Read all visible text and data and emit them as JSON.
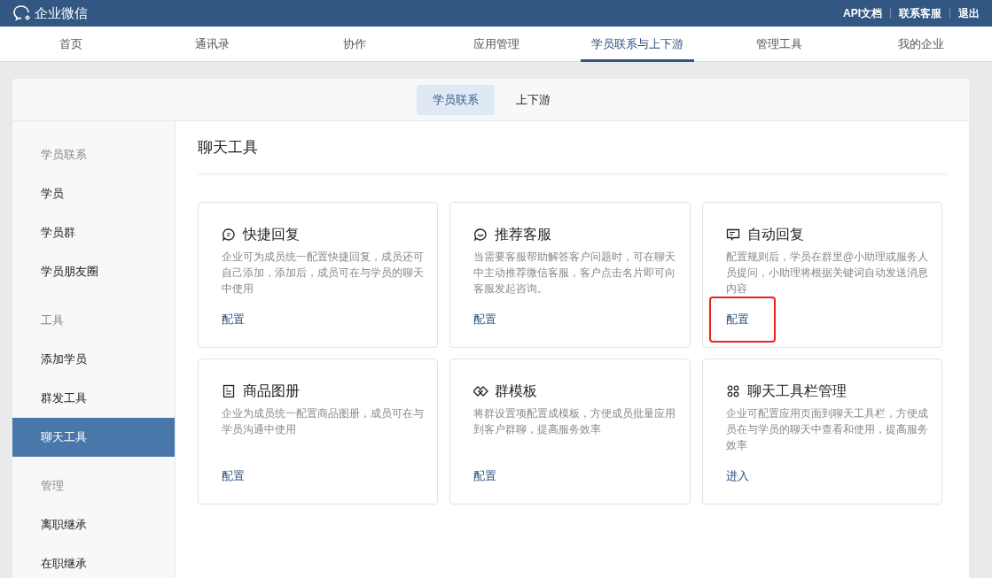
{
  "header": {
    "logo": "企业微信",
    "links": [
      "API文档",
      "联系客服",
      "退出"
    ]
  },
  "nav": [
    {
      "label": "首页",
      "selected": false
    },
    {
      "label": "通讯录",
      "selected": false
    },
    {
      "label": "协作",
      "selected": false
    },
    {
      "label": "应用管理",
      "selected": false
    },
    {
      "label": "学员联系与上下游",
      "selected": true
    },
    {
      "label": "管理工具",
      "selected": false
    },
    {
      "label": "我的企业",
      "selected": false
    }
  ],
  "subtabs": [
    {
      "label": "学员联系",
      "selected": true
    },
    {
      "label": "上下游",
      "selected": false
    }
  ],
  "sidebar": [
    {
      "kind": "header",
      "label": "学员联系"
    },
    {
      "kind": "item",
      "label": "学员",
      "selected": false
    },
    {
      "kind": "item",
      "label": "学员群",
      "selected": false
    },
    {
      "kind": "item",
      "label": "学员朋友圈",
      "selected": false
    },
    {
      "kind": "header",
      "label": "工具"
    },
    {
      "kind": "item",
      "label": "添加学员",
      "selected": false
    },
    {
      "kind": "item",
      "label": "群发工具",
      "selected": false
    },
    {
      "kind": "item",
      "label": "聊天工具",
      "selected": true
    },
    {
      "kind": "header",
      "label": "管理"
    },
    {
      "kind": "item",
      "label": "离职继承",
      "selected": false
    },
    {
      "kind": "item",
      "label": "在职继承",
      "selected": false
    }
  ],
  "page_title": "聊天工具",
  "cards": [
    {
      "kind": "quick",
      "title": "快捷回复",
      "description": "企业可为成员统一配置快捷回复，成员还可自己添加，添加后，成员可在与学员的聊天中使用",
      "action": "配置",
      "highlighted": false
    },
    {
      "kind": "service",
      "title": "推荐客服",
      "description": "当需要客服帮助解答客户问题时，可在聊天中主动推荐微信客服，客户点击名片即可向客服发起咨询。",
      "action": "配置",
      "highlighted": false
    },
    {
      "kind": "auto",
      "title": "自动回复",
      "description": "配置规则后，学员在群里@小助理或服务人员提问，小助理将根据关键词自动发送消息内容",
      "action": "配置",
      "highlighted": true
    },
    {
      "kind": "album",
      "title": "商品图册",
      "description": "企业为成员统一配置商品图册，成员可在与学员沟通中使用",
      "action": "配置",
      "highlighted": false
    },
    {
      "kind": "template",
      "title": "群模板",
      "description": "将群设置项配置成模板，方便成员批量应用到客户群聊，提高服务效率",
      "action": "配置",
      "highlighted": false
    },
    {
      "kind": "toolbar",
      "title": "聊天工具栏管理",
      "description": "企业可配置应用页面到聊天工具栏，方便成员在与学员的聊天中查看和使用，提高服务效率",
      "action": "进入",
      "highlighted": false
    }
  ]
}
